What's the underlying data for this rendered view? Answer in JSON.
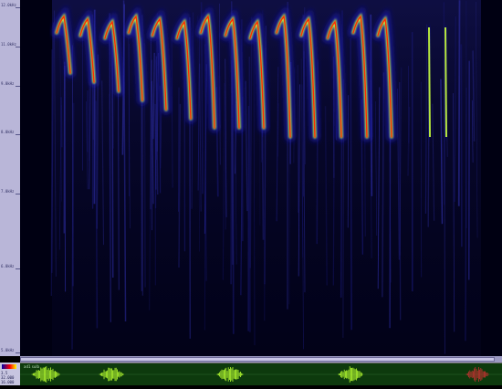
{
  "freq_axis": {
    "labels": [
      "12.0kHz",
      "11.0kHz",
      "9.0kHz",
      "8.0kHz",
      "7.0kHz",
      "6.0kHz",
      "5.0kHz"
    ]
  },
  "status": {
    "line1": "3.5",
    "line2": "32.000",
    "line3": "16.000"
  },
  "waveform": {
    "label": "ad1 sulb"
  },
  "colors": {
    "background": "#000010",
    "ruler": "#b9b6d8",
    "call_core": "#ff2a00",
    "call_mid": "#c9ff3a",
    "waveform_bg": "#0d3a0d",
    "waveform_burst": "#b8ff30"
  }
}
